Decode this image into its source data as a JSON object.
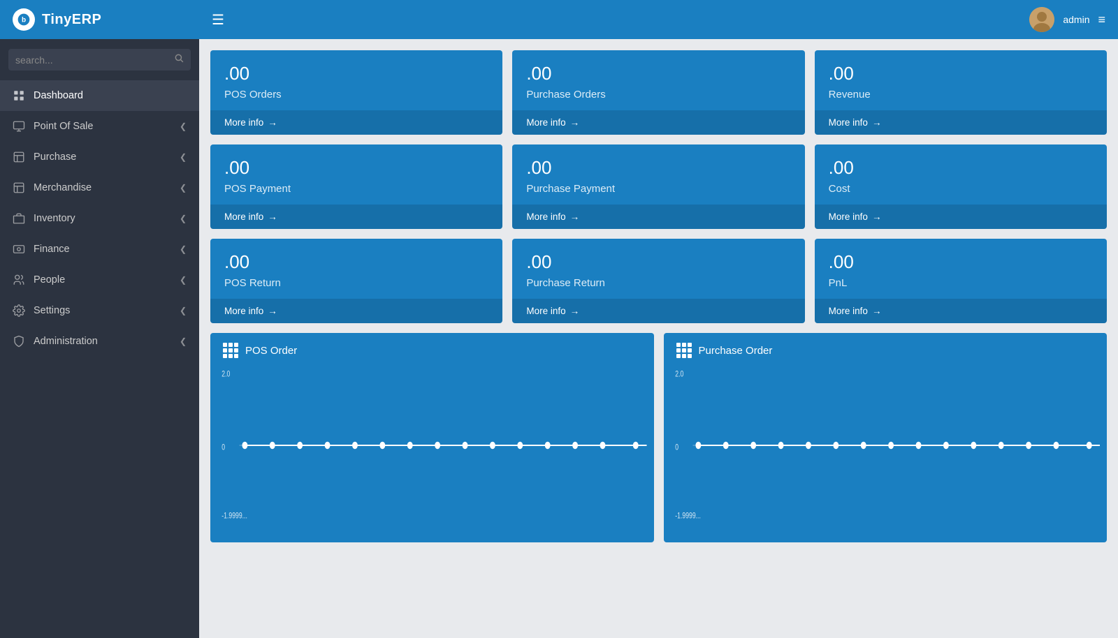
{
  "app": {
    "name": "TinyERP"
  },
  "topbar": {
    "admin_name": "admin"
  },
  "search": {
    "placeholder": "search..."
  },
  "sidebar": {
    "items": [
      {
        "id": "dashboard",
        "label": "Dashboard",
        "icon": "dashboard-icon",
        "has_chevron": false
      },
      {
        "id": "point-of-sale",
        "label": "Point Of Sale",
        "icon": "pos-icon",
        "has_chevron": true
      },
      {
        "id": "purchase",
        "label": "Purchase",
        "icon": "purchase-icon",
        "has_chevron": true
      },
      {
        "id": "merchandise",
        "label": "Merchandise",
        "icon": "merchandise-icon",
        "has_chevron": true
      },
      {
        "id": "inventory",
        "label": "Inventory",
        "icon": "inventory-icon",
        "has_chevron": true
      },
      {
        "id": "finance",
        "label": "Finance",
        "icon": "finance-icon",
        "has_chevron": true
      },
      {
        "id": "people",
        "label": "People",
        "icon": "people-icon",
        "has_chevron": true
      },
      {
        "id": "settings",
        "label": "Settings",
        "icon": "settings-icon",
        "has_chevron": true
      },
      {
        "id": "administration",
        "label": "Administration",
        "icon": "admin-icon",
        "has_chevron": true
      }
    ]
  },
  "cards": [
    {
      "id": "pos-orders",
      "value": ".00",
      "label": "POS Orders",
      "footer": "More info"
    },
    {
      "id": "purchase-orders",
      "value": ".00",
      "label": "Purchase Orders",
      "footer": "More info"
    },
    {
      "id": "revenue",
      "value": ".00",
      "label": "Revenue",
      "footer": "More info"
    },
    {
      "id": "pos-payment",
      "value": ".00",
      "label": "POS Payment",
      "footer": "More info"
    },
    {
      "id": "purchase-payment",
      "value": ".00",
      "label": "Purchase Payment",
      "footer": "More info"
    },
    {
      "id": "cost",
      "value": ".00",
      "label": "Cost",
      "footer": "More info"
    },
    {
      "id": "pos-return",
      "value": ".00",
      "label": "POS Return",
      "footer": "More info"
    },
    {
      "id": "purchase-return",
      "value": ".00",
      "label": "Purchase Return",
      "footer": "More info"
    },
    {
      "id": "pnl",
      "value": ".00",
      "label": "PnL",
      "footer": "More info"
    }
  ],
  "charts": [
    {
      "id": "pos-order-chart",
      "title": "POS Order",
      "y_max": "2.0",
      "y_zero": "0",
      "y_min": "-1.9999999999999998"
    },
    {
      "id": "purchase-order-chart",
      "title": "Purchase Order",
      "y_max": "2.0",
      "y_zero": "0",
      "y_min": "-1.9999999999999998"
    }
  ]
}
